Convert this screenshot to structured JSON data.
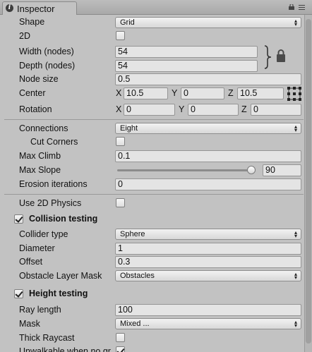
{
  "window": {
    "tab_label": "Inspector"
  },
  "grid": {
    "shape_label": "Shape",
    "shape_value": "Grid",
    "twod_label": "2D",
    "width_label": "Width (nodes)",
    "width_value": "54",
    "depth_label": "Depth (nodes)",
    "depth_value": "54",
    "node_size_label": "Node size",
    "node_size_value": "0.5",
    "center_label": "Center",
    "center_x": "10.5",
    "center_y": "0",
    "center_z": "10.5",
    "rotation_label": "Rotation",
    "rotation_x": "0",
    "rotation_y": "0",
    "rotation_z": "0",
    "axis_x": "X",
    "axis_y": "Y",
    "axis_z": "Z"
  },
  "connections": {
    "connections_label": "Connections",
    "connections_value": "Eight",
    "cut_corners_label": "Cut Corners",
    "max_climb_label": "Max Climb",
    "max_climb_value": "0.1",
    "max_slope_label": "Max Slope",
    "max_slope_value": "90",
    "erosion_label": "Erosion iterations",
    "erosion_value": "0"
  },
  "collision": {
    "use_2d_physics_label": "Use 2D Physics",
    "title": "Collision testing",
    "collider_type_label": "Collider type",
    "collider_type_value": "Sphere",
    "diameter_label": "Diameter",
    "diameter_value": "1",
    "offset_label": "Offset",
    "offset_value": "0.3",
    "obstacle_mask_label": "Obstacle Layer Mask",
    "obstacle_mask_value": "Obstacles"
  },
  "height": {
    "title": "Height testing",
    "ray_length_label": "Ray length",
    "ray_length_value": "100",
    "mask_label": "Mask",
    "mask_value": "Mixed ...",
    "thick_raycast_label": "Thick Raycast",
    "unwalkable_label": "Unwalkable when no gr"
  },
  "state": {
    "twod_checked": false,
    "cut_corners_checked": false,
    "use_2d_physics_checked": false,
    "collision_checked": true,
    "height_checked": true,
    "thick_raycast_checked": false,
    "unwalkable_checked": true,
    "max_slope_fraction": 1.0
  }
}
